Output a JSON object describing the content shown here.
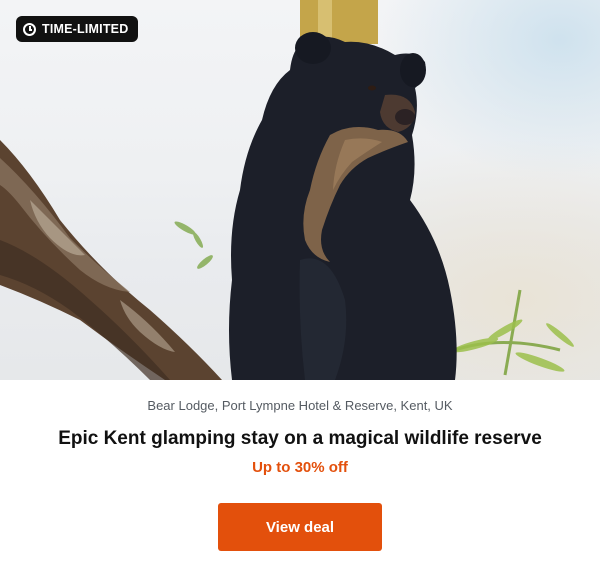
{
  "badge": {
    "label": "TIME-LIMITED",
    "icon": "clock-icon"
  },
  "image": {
    "subject": "black bear on a tree branch"
  },
  "deal": {
    "location": "Bear Lodge, Port Lympne Hotel & Reserve, Kent, UK",
    "title": "Epic Kent glamping stay on a magical wildlife reserve",
    "offer": "Up to 30% off",
    "cta_label": "View deal"
  },
  "colors": {
    "accent": "#e3500c",
    "badge_bg": "#111111",
    "title": "#111111",
    "location": "#555b62"
  }
}
